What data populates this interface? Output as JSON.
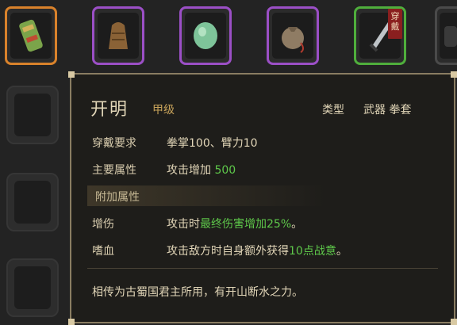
{
  "inventory": {
    "slots": [
      {
        "name": "fist-wrap",
        "rarity": "orange"
      },
      {
        "name": "leather-glove",
        "rarity": "purple"
      },
      {
        "name": "jade-stone",
        "rarity": "purple"
      },
      {
        "name": "pouch",
        "rarity": "purple"
      },
      {
        "name": "dagger",
        "rarity": "green",
        "tag": "穿戴"
      },
      {
        "name": "dark-item",
        "rarity": "grey"
      }
    ]
  },
  "tooltip": {
    "name": "开明",
    "grade": "甲级",
    "type_label": "类型",
    "type_value": "武器 拳套",
    "requirement_label": "穿戴要求",
    "requirement_value": "拳掌100、臂力10",
    "main_attr_label": "主要属性",
    "main_attr_prefix": "攻击增加",
    "main_attr_value": "500",
    "extra_section": "附加属性",
    "extras": [
      {
        "label": "增伤",
        "prefix": "攻击时",
        "highlight": "最终伤害增加25%",
        "suffix": "。"
      },
      {
        "label": "嗜血",
        "prefix": "攻击敌方时自身额外获得",
        "highlight": "10点战意",
        "suffix": "。"
      }
    ],
    "lore": "相传为古蜀国君主所用，有开山断水之力。"
  },
  "colors": {
    "orange": "#d9822b",
    "purple": "#9b4fc6",
    "green": "#4fae3c",
    "highlight": "#5ec84a",
    "gold": "#c7a25a"
  }
}
